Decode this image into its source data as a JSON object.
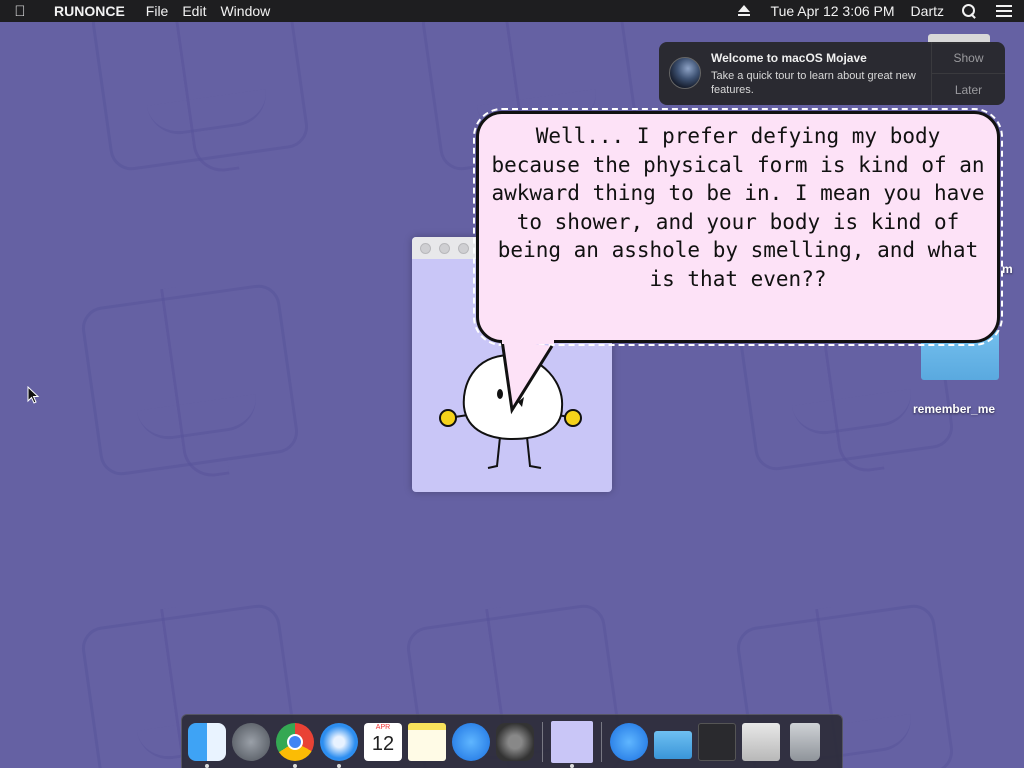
{
  "menubar": {
    "apple_icon": "apple-icon",
    "app_name": "RUNONCE",
    "menus": [
      "File",
      "Edit",
      "Window"
    ],
    "clock": "Tue Apr 12  3:06 PM",
    "user": "Dartz"
  },
  "notification": {
    "title": "Welcome to macOS Mojave",
    "body": "Take a quick tour to learn about great new features.",
    "show_label": "Show",
    "later_label": "Later"
  },
  "speech_bubble": {
    "text": "Well... I prefer defying my body because the physical form is kind of an awkward thing to be in. I mean you have to shower, and your body is kind of being an asshole by smelling, and what is that even??"
  },
  "desktop": {
    "icons": [
      {
        "label": "remember_me",
        "icon": "folder-icon"
      },
      {
        "label": "m",
        "icon": "file-icon"
      }
    ]
  },
  "dock": {
    "items": [
      {
        "name": "Finder",
        "icon": "finder-icon",
        "running": true
      },
      {
        "name": "Launchpad",
        "icon": "launchpad-icon",
        "running": false
      },
      {
        "name": "Google Chrome",
        "icon": "chrome-icon",
        "running": true
      },
      {
        "name": "Safari",
        "icon": "safari-icon",
        "running": true
      },
      {
        "name": "Calendar",
        "icon": "calendar-icon",
        "running": false,
        "month": "APR",
        "day": "12"
      },
      {
        "name": "Notes",
        "icon": "notes-icon",
        "running": false
      },
      {
        "name": "App Store",
        "icon": "app-store-icon",
        "running": false
      },
      {
        "name": "System Preferences",
        "icon": "system-preferences-icon",
        "running": false
      },
      {
        "name": "RUNONCE",
        "icon": "runonce-app-icon",
        "running": true
      },
      {
        "name": "Applications",
        "icon": "applications-folder-icon",
        "running": false
      },
      {
        "name": "Documents",
        "icon": "documents-folder-icon",
        "running": false
      },
      {
        "name": "Screen Recording",
        "icon": "screen-recording-icon",
        "running": false
      },
      {
        "name": "Downloads",
        "icon": "downloads-stack-icon",
        "running": false
      },
      {
        "name": "Trash",
        "icon": "trash-icon",
        "running": false
      }
    ]
  },
  "colors": {
    "desktop_bg": "#6561a3",
    "bubble_fill": "#fde2f7",
    "app_window_bg": "#c9c6f7",
    "menubar_bg": "#1e1e20"
  }
}
